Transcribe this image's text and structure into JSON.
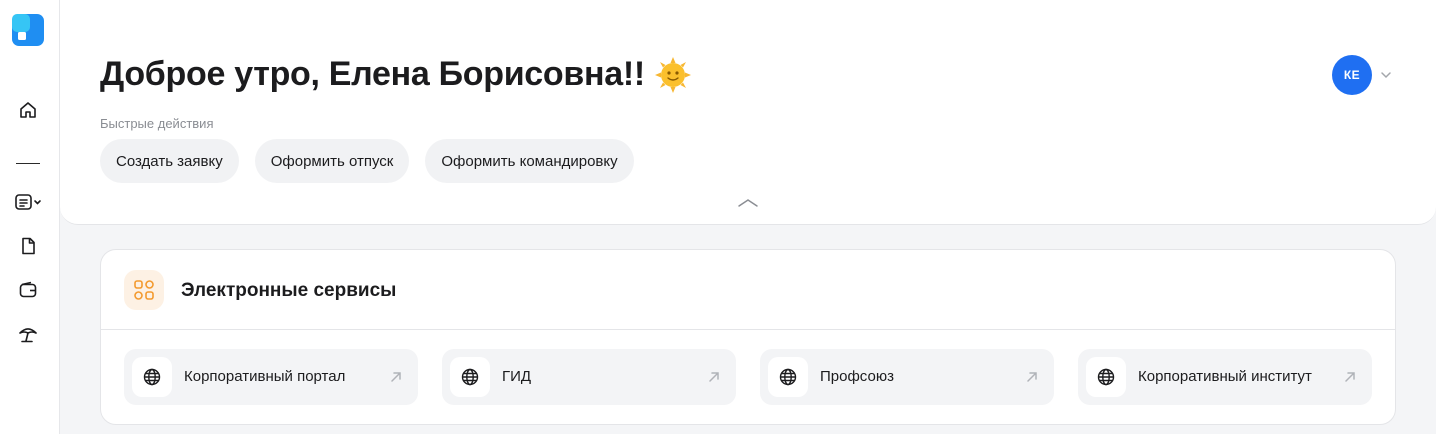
{
  "sidebar": {
    "logo_icon": "app-logo",
    "items": [
      {
        "icon": "home-icon"
      },
      {
        "icon": "list-dropdown-icon"
      },
      {
        "icon": "document-icon"
      },
      {
        "icon": "wallet-icon"
      },
      {
        "icon": "beach-umbrella-icon"
      }
    ]
  },
  "header": {
    "greeting": "Доброе утро, Елена Борисовна!!",
    "greeting_icon": "sun-emoji",
    "quick_actions_label": "Быстрые действия",
    "quick_actions": [
      "Создать заявку",
      "Оформить отпуск",
      "Оформить командировку"
    ],
    "user": {
      "initials": "КЕ",
      "avatar_color": "#1f6ff2"
    }
  },
  "services": {
    "title": "Электронные сервисы",
    "icon": "grid-shapes-icon",
    "items": [
      {
        "label": "Корпоративный портал",
        "icon": "globe-icon"
      },
      {
        "label": "ГИД",
        "icon": "globe-icon"
      },
      {
        "label": "Профсоюз",
        "icon": "globe-icon"
      },
      {
        "label": "Корпоративный институт",
        "icon": "globe-icon"
      }
    ]
  },
  "colors": {
    "accent": "#1f6ff2",
    "service_icon_bg": "#fdf1e4",
    "service_icon": "#f39a2f"
  }
}
